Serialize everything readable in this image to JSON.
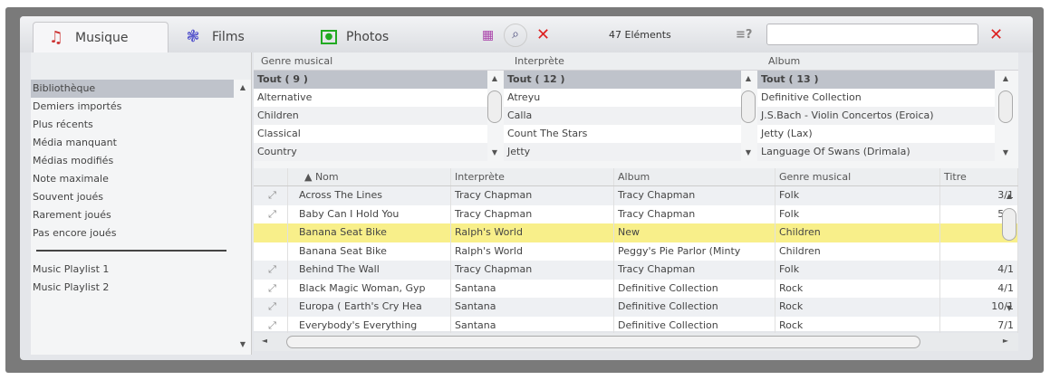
{
  "tabs": [
    {
      "label": "Musique",
      "icon": "music-note-icon"
    },
    {
      "label": "Films",
      "icon": "film-reel-icon"
    },
    {
      "label": "Photos",
      "icon": "photo-icon"
    }
  ],
  "toolbar": {
    "count": "47 Eléments",
    "help": "≡?",
    "search_value": ""
  },
  "sidebar": {
    "items": [
      "Bibliothèque",
      "Demiers importés",
      "Plus récents",
      "Média manquant",
      "Médias modifiés",
      "Note maximale",
      "Souvent joués",
      "Rarement joués",
      "Pas encore joués"
    ],
    "playlists": [
      "Music Playlist 1",
      "Music Playlist 2"
    ]
  },
  "filters": [
    {
      "header": "Genre musical",
      "items": [
        "Tout ( 9 )",
        "Alternative",
        "Children",
        "Classical",
        "Country"
      ]
    },
    {
      "header": "Interprète",
      "items": [
        "Tout ( 12 )",
        "Atreyu",
        "Calla",
        "Count The Stars",
        "Jetty"
      ]
    },
    {
      "header": "Album",
      "items": [
        "Tout ( 13 )",
        "Definitive Collection",
        "J.S.Bach - Violin Concertos (Eroica)",
        "Jetty (Lax)",
        "Language Of Swans (Drimala)"
      ]
    }
  ],
  "table": {
    "columns": [
      "▲ Nom",
      "Interprète",
      "Album",
      "Genre musical",
      "Titre"
    ],
    "rows": [
      [
        "Across The Lines",
        "Tracy Chapman",
        "Tracy Chapman",
        "Folk",
        "3/1"
      ],
      [
        "Baby Can I Hold You",
        "Tracy Chapman",
        "Tracy Chapman",
        "Folk",
        "5/1"
      ],
      [
        "Banana Seat Bike",
        "Ralph's World",
        "New",
        "Children",
        ""
      ],
      [
        "Banana Seat Bike",
        "Ralph's World",
        "Peggy's Pie Parlor (Minty",
        "Children",
        ""
      ],
      [
        "Behind The Wall",
        "Tracy Chapman",
        "Tracy Chapman",
        "Folk",
        "4/1"
      ],
      [
        "Black Magic Woman, Gyp",
        "Santana",
        "Definitive Collection",
        "Rock",
        "4/1"
      ],
      [
        "Europa ( Earth's Cry Hea",
        "Santana",
        "Definitive Collection",
        "Rock",
        "10/1"
      ],
      [
        "Everybody's Everything",
        "Santana",
        "Definitive Collection",
        "Rock",
        "7/1"
      ]
    ]
  }
}
